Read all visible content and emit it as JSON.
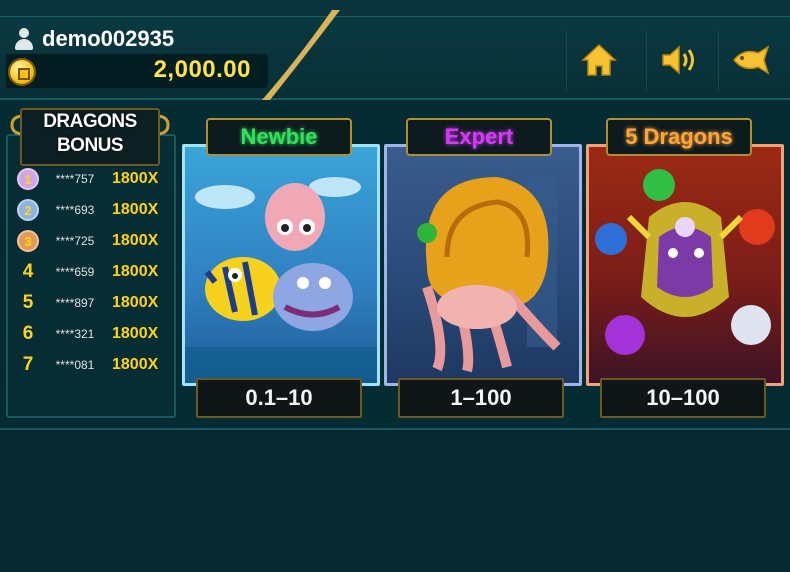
{
  "header": {
    "username": "demo002935",
    "balance": "2,000.00",
    "buttons": [
      {
        "name": "home-button",
        "icon": "home-icon"
      },
      {
        "name": "sound-button",
        "icon": "speaker-icon"
      },
      {
        "name": "fish-button",
        "icon": "fish-icon"
      }
    ]
  },
  "bonus": {
    "title_line1": "DRAGONS",
    "title_line2": "BONUS",
    "rows": [
      {
        "rank": "1",
        "player": "****757",
        "multiplier": "1800X",
        "medal": "#d1a4e6"
      },
      {
        "rank": "2",
        "player": "****693",
        "multiplier": "1800X",
        "medal": "#8fb1e3"
      },
      {
        "rank": "3",
        "player": "****725",
        "multiplier": "1800X",
        "medal": "#e29a55"
      },
      {
        "rank": "4",
        "player": "****659",
        "multiplier": "1800X"
      },
      {
        "rank": "5",
        "player": "****897",
        "multiplier": "1800X"
      },
      {
        "rank": "6",
        "player": "****321",
        "multiplier": "1800X"
      },
      {
        "rank": "7",
        "player": "****081",
        "multiplier": "1800X"
      }
    ]
  },
  "rooms": [
    {
      "label": "Newbie",
      "range": "0.1–10",
      "label_color": "#32e05a"
    },
    {
      "label": "Expert",
      "range": "1–100",
      "label_color": "#d23cf5"
    },
    {
      "label": "5 Dragons",
      "range": "10–100",
      "label_color": "#ffa53a"
    }
  ]
}
